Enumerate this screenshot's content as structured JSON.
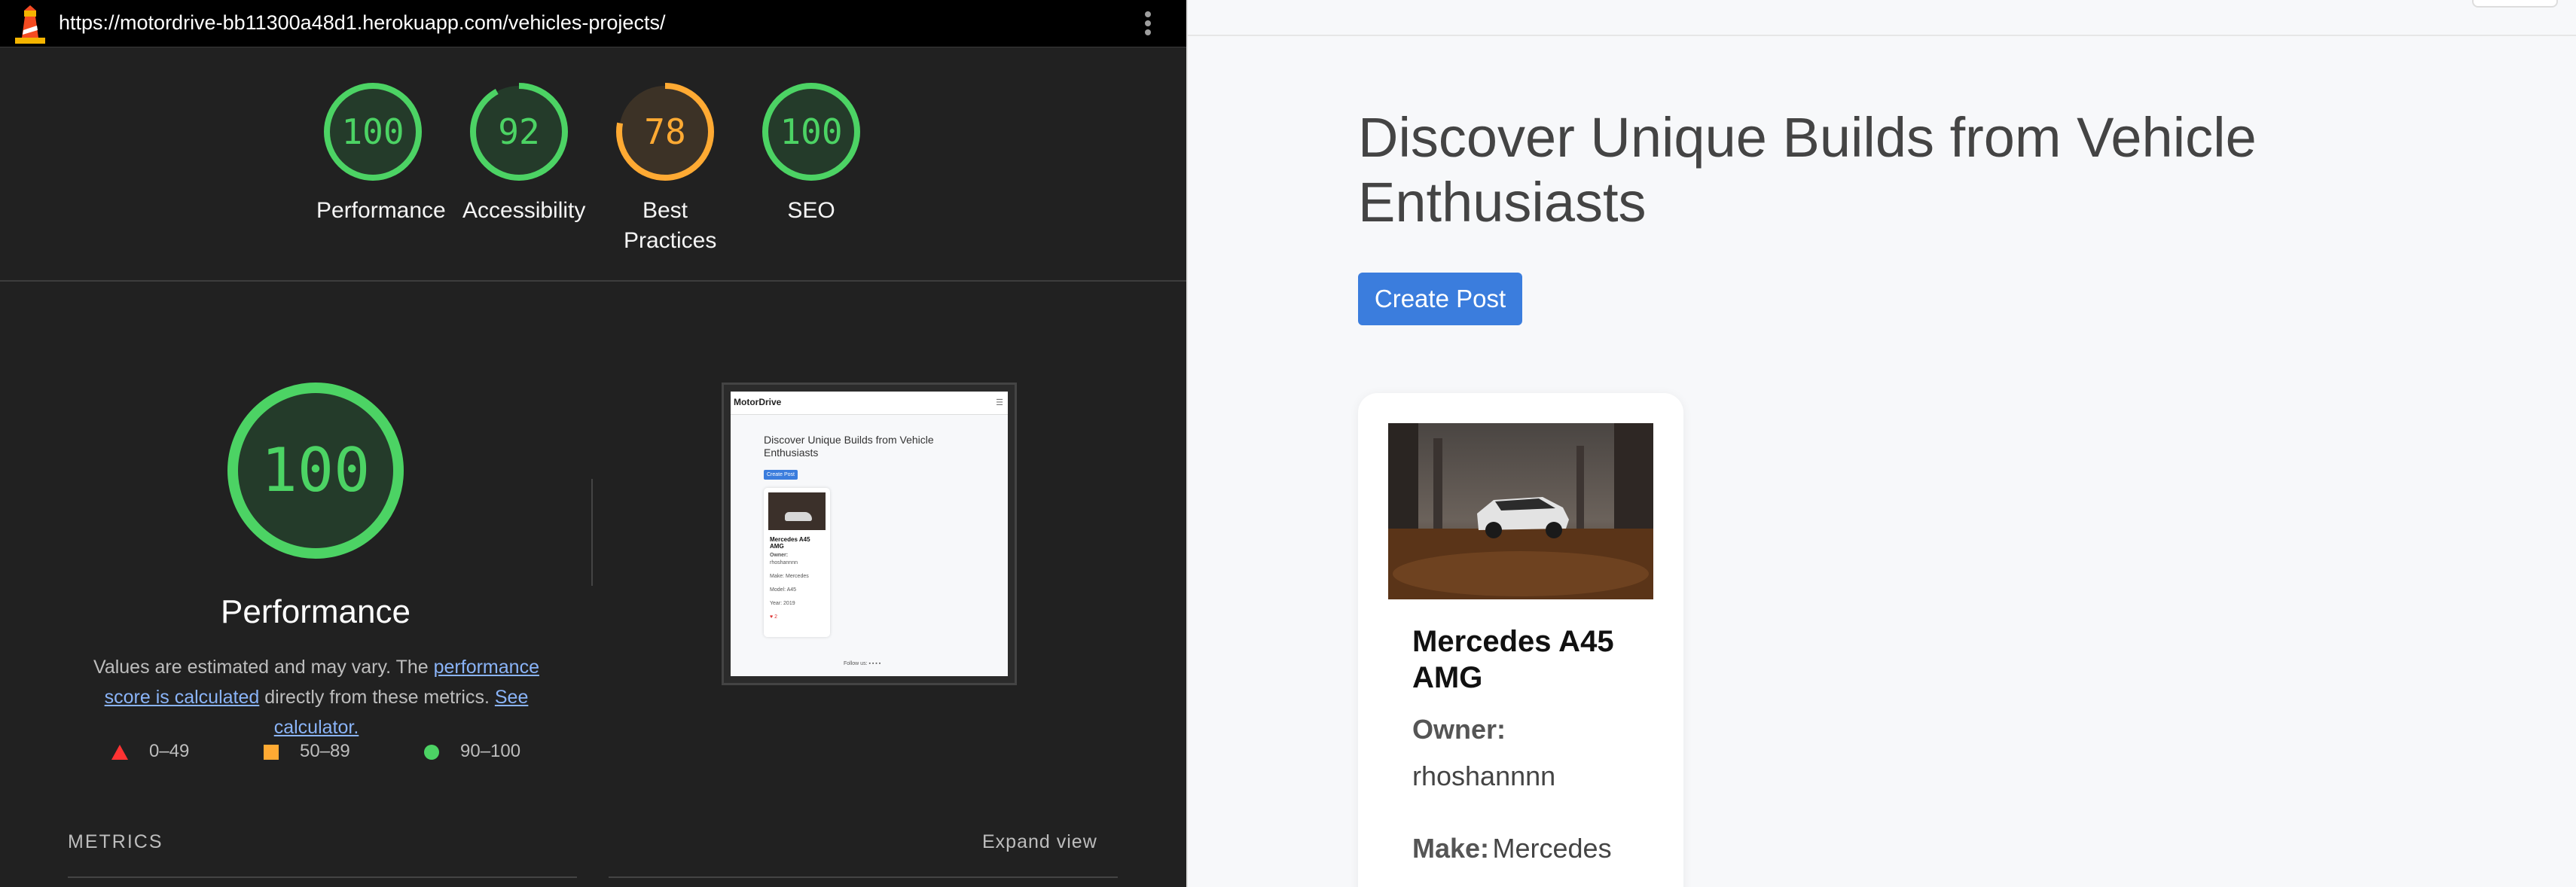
{
  "lighthouse": {
    "url": "https://motordrive-bb11300a48d1.herokuapp.com/vehicles-projects/",
    "gauges": [
      {
        "score": 100,
        "label": "Performance",
        "color": "#4cd364"
      },
      {
        "score": 92,
        "label": "Accessibility",
        "color": "#4cd364"
      },
      {
        "score": 78,
        "label": "Best Practices",
        "color": "#fa3"
      },
      {
        "score": 100,
        "label": "SEO",
        "color": "#4cd364"
      }
    ],
    "main": {
      "score": 100,
      "title": "Performance",
      "desc_prefix": "Values are estimated and may vary. The ",
      "desc_link1": "performance score is calculated",
      "desc_middle": " directly from these metrics. ",
      "desc_link2": "See calculator."
    },
    "legend": [
      {
        "shape": "triangle",
        "label": "0–49",
        "color": "#f33"
      },
      {
        "shape": "square",
        "label": "50–89",
        "color": "#fa3"
      },
      {
        "shape": "circle",
        "label": "90–100",
        "color": "#4cd364"
      }
    ],
    "metrics_heading": "METRICS",
    "expand_label": "Expand view",
    "thumbnail": {
      "brand": "MotorDrive",
      "title": "Discover Unique Builds from Vehicle Enthusiasts",
      "button": "Create Post",
      "card_title": "Mercedes A45 AMG",
      "owner_label": "Owner:",
      "owner": "rhoshannnn",
      "make": "Make: Mercedes",
      "model": "Model: A45",
      "year": "Year: 2019",
      "likes": "♥ 2",
      "footer": "Follow us: ▪ ▪ ▪ ▪"
    }
  },
  "site": {
    "title": "Discover Unique Builds from Vehicle Enthusiasts",
    "create_post": "Create Post",
    "card": {
      "name": "Mercedes A45 AMG",
      "owner_label": "Owner:",
      "owner": "rhoshannnn",
      "make_label": "Make:",
      "make": "Mercedes"
    }
  }
}
